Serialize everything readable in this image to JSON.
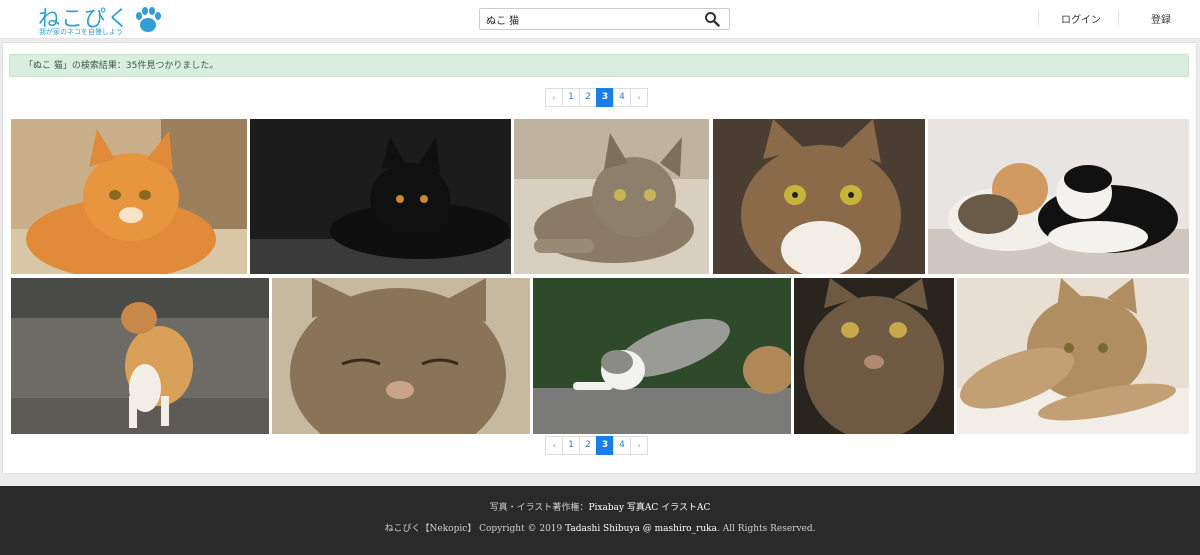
{
  "header": {
    "logo_text": "ねこぴく",
    "logo_tagline": "我が家のネコを自慢しよう",
    "search_value": "ぬこ 猫",
    "login_label": "ログイン",
    "register_label": "登録"
  },
  "results": {
    "message": "「ぬこ 猫」の検索結果：35件見つかりました。"
  },
  "pagination": {
    "prev": "‹",
    "next": "›",
    "pages": [
      "1",
      "2",
      "3",
      "4"
    ],
    "current": "3"
  },
  "footer": {
    "credit_prefix": "写真・イラスト著作権：",
    "credit_links": [
      "Pixabay",
      "写真AC",
      "イラストAC"
    ],
    "copyright_prefix": "ねこぴく【Nekopic】 Copyright © 2019 ",
    "copyright_author": "Tadashi Shibuya @ mashiro_ruka",
    "copyright_suffix": ". All Rights Reserved."
  }
}
